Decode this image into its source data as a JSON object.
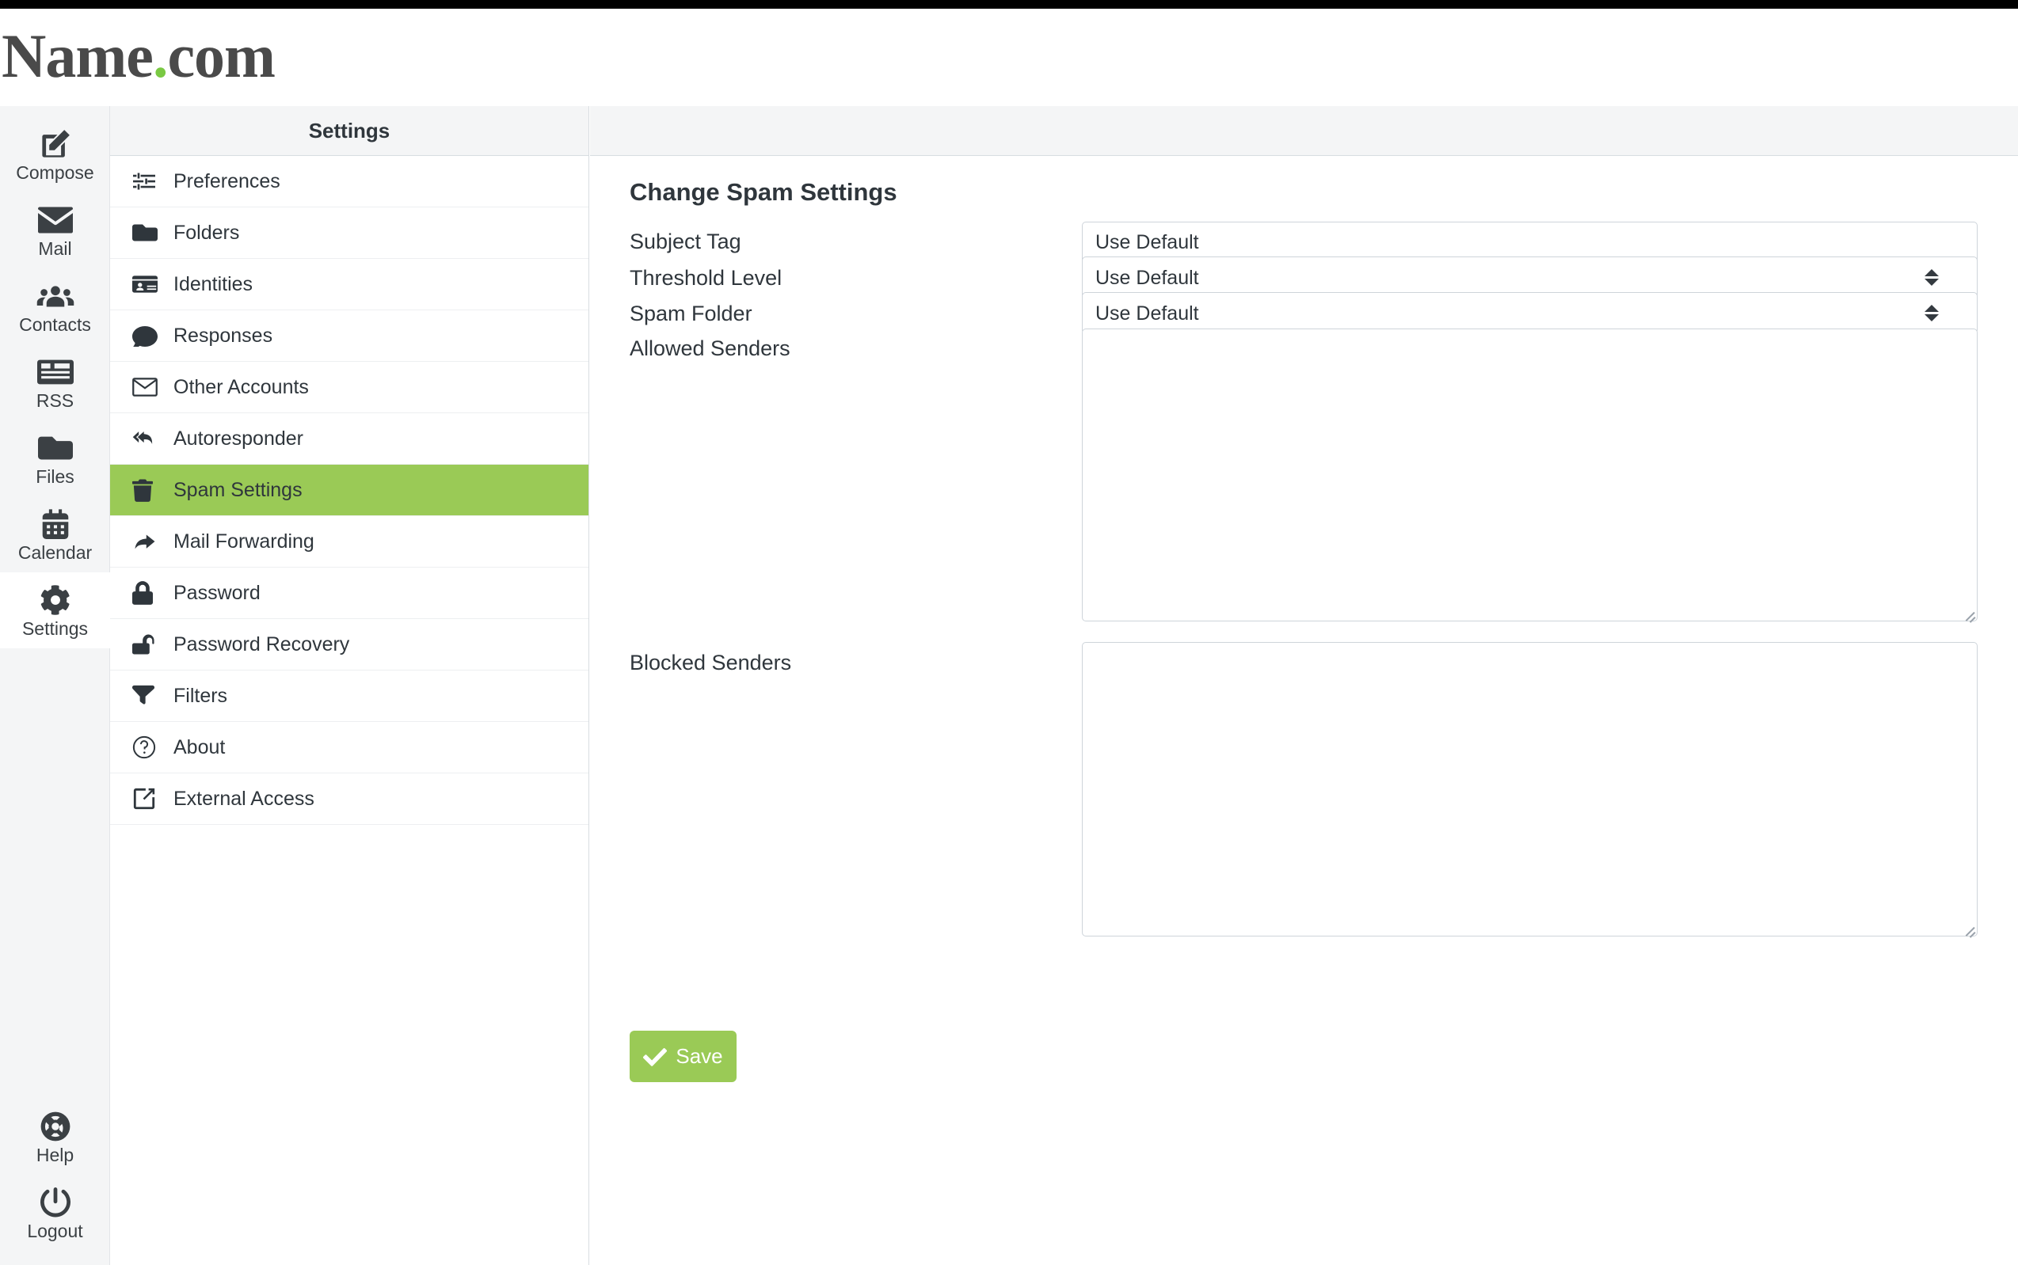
{
  "brand": {
    "name_first": "Name",
    "dot": ".",
    "name_last": "com",
    "dot_color": "#7ac943"
  },
  "rail": {
    "items": [
      {
        "label": "Compose",
        "icon": "compose-icon",
        "active": false
      },
      {
        "label": "Mail",
        "icon": "envelope-icon",
        "active": false
      },
      {
        "label": "Contacts",
        "icon": "contacts-icon",
        "active": false
      },
      {
        "label": "RSS",
        "icon": "rss-feed-icon",
        "active": false
      },
      {
        "label": "Files",
        "icon": "folder-icon",
        "active": false
      },
      {
        "label": "Calendar",
        "icon": "calendar-icon",
        "active": false
      },
      {
        "label": "Settings",
        "icon": "gear-icon",
        "active": true
      }
    ],
    "bottom_items": [
      {
        "label": "Help",
        "icon": "life-ring-icon"
      },
      {
        "label": "Logout",
        "icon": "power-icon"
      }
    ]
  },
  "settings_panel": {
    "header": "Settings",
    "active_color": "#9aca56",
    "items": [
      {
        "label": "Preferences",
        "icon": "sliders-icon",
        "active": false
      },
      {
        "label": "Folders",
        "icon": "folder-icon",
        "active": false
      },
      {
        "label": "Identities",
        "icon": "id-card-icon",
        "active": false
      },
      {
        "label": "Responses",
        "icon": "comment-icon",
        "active": false
      },
      {
        "label": "Other Accounts",
        "icon": "envelope-icon",
        "active": false
      },
      {
        "label": "Autoresponder",
        "icon": "reply-all-icon",
        "active": false
      },
      {
        "label": "Spam Settings",
        "icon": "trash-icon",
        "active": true
      },
      {
        "label": "Mail Forwarding",
        "icon": "share-arrow-icon",
        "active": false
      },
      {
        "label": "Password",
        "icon": "lock-icon",
        "active": false
      },
      {
        "label": "Password Recovery",
        "icon": "unlock-icon",
        "active": false
      },
      {
        "label": "Filters",
        "icon": "filter-icon",
        "active": false
      },
      {
        "label": "About",
        "icon": "question-circle-icon",
        "active": false
      },
      {
        "label": "External Access",
        "icon": "external-link-icon",
        "active": false
      }
    ]
  },
  "form": {
    "title": "Change Spam Settings",
    "subject_tag": {
      "label": "Subject Tag",
      "value": "Use Default",
      "placeholder": ""
    },
    "threshold_level": {
      "label": "Threshold Level",
      "value": "Use Default"
    },
    "spam_folder": {
      "label": "Spam Folder",
      "value": "Use Default"
    },
    "allowed_senders": {
      "label": "Allowed Senders",
      "value": "",
      "placeholder": ""
    },
    "blocked_senders": {
      "label": "Blocked Senders",
      "value": "",
      "placeholder": ""
    },
    "save": {
      "label": "Save",
      "icon": "check-icon",
      "color": "#9aca56"
    }
  }
}
